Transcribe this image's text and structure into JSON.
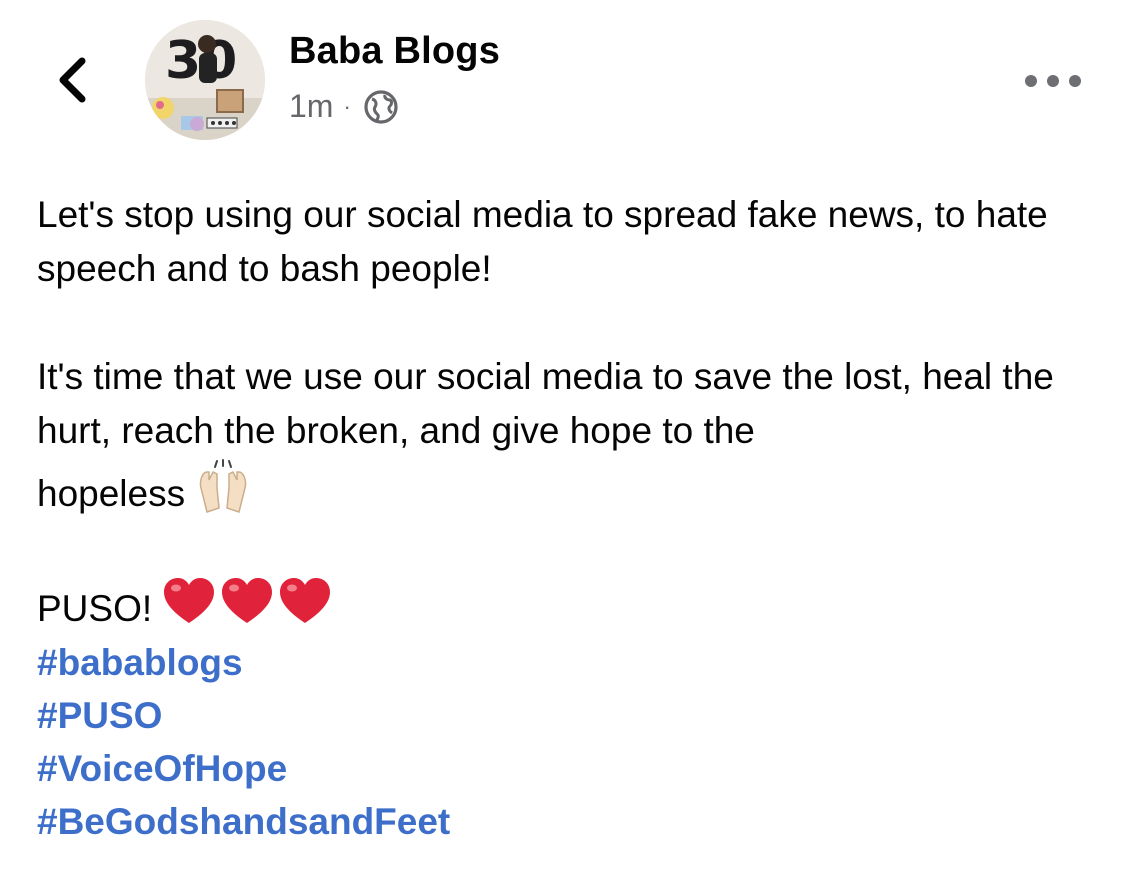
{
  "header": {
    "back_icon": "chevron-left-icon",
    "author_name": "Baba Blogs",
    "timestamp": "1m",
    "separator": "·",
    "privacy_icon": "globe-icon",
    "more_icon": "more-horizontal-icon"
  },
  "post": {
    "paragraph1": "Let's stop using our social media to spread fake news, to hate speech and to bash people!",
    "paragraph2_line": "It's time that we use our social media to save the lost, heal the hurt, reach the broken, and give hope to the",
    "paragraph2_tail": "hopeless",
    "raising_hands_icon": "raising-hands-emoji",
    "closing": "PUSO!",
    "hearts_icon": "red-heart-emoji",
    "hashtags": [
      "#babablogs",
      "#PUSO",
      "#VoiceOfHope",
      "#BeGodshandsandFeet"
    ]
  },
  "colors": {
    "text": "#050505",
    "meta": "#65676b",
    "hashtag": "#3d6fca",
    "heart": "#e0233a"
  }
}
